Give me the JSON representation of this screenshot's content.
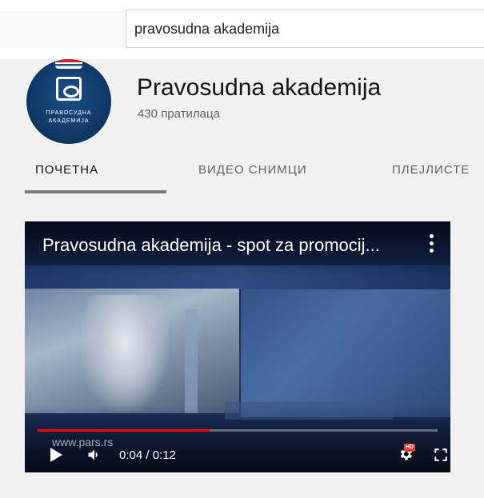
{
  "search": {
    "value": "pravosudna akademija"
  },
  "channel": {
    "name": "Pravosudna akademija",
    "subscribers": "430 пратилаца",
    "avatar_text_line1": "ПРАВОСУДНА",
    "avatar_text_line2": "АКАДЕМИЈА"
  },
  "tabs": [
    {
      "label": "ПОЧЕТНА",
      "active": true
    },
    {
      "label": "ВИДЕО СНИМЦИ",
      "active": false
    },
    {
      "label": "ПЛЕЈЛИСТЕ",
      "active": false
    }
  ],
  "player": {
    "title": "Pravosudna akademija - spot za promocij...",
    "watermark": "www.pars.rs",
    "time": "0:04 / 0:12",
    "progress_fraction": 0.43,
    "hd_label": "HD"
  },
  "icons": {
    "more": "more-vert-icon",
    "play": "play-icon",
    "volume": "volume-icon",
    "settings": "gear-icon",
    "fullscreen": "fullscreen-icon"
  },
  "colors": {
    "progress": "#ff0000",
    "hd_badge": "#e53935",
    "tab_underline": "#7b7b7b"
  }
}
